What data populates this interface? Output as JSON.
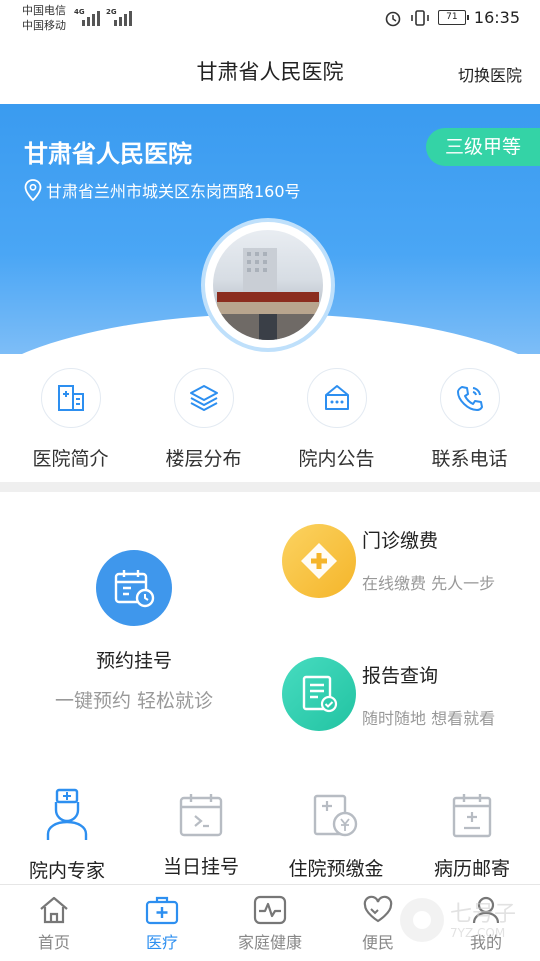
{
  "status_bar": {
    "carrier_1": "中国电信",
    "carrier_2": "中国移动",
    "net_1": "4G",
    "net_2": "2G",
    "battery": "71",
    "time": "16:35"
  },
  "header": {
    "title": "甘肃省人民医院",
    "switch_label": "切换医院"
  },
  "banner": {
    "hospital_name": "甘肃省人民医院",
    "grade": "三级甲等",
    "address": "甘肃省兰州市城关区东岗西路160号"
  },
  "quick_actions": [
    {
      "label": "医院简介",
      "icon": "building-icon"
    },
    {
      "label": "楼层分布",
      "icon": "layers-icon"
    },
    {
      "label": "院内公告",
      "icon": "notice-icon"
    },
    {
      "label": "联系电话",
      "icon": "phone-icon"
    }
  ],
  "services": {
    "appointment": {
      "title": "预约挂号",
      "subtitle": "一键预约 轻松就诊"
    },
    "payment": {
      "title": "门诊缴费",
      "subtitle": "在线缴费 先人一步"
    },
    "report": {
      "title": "报告查询",
      "subtitle": "随时随地 想看就看"
    }
  },
  "bottom_services": [
    {
      "label": "院内专家",
      "icon": "doctor-icon"
    },
    {
      "label": "当日挂号",
      "icon": "calendar-today-icon"
    },
    {
      "label": "住院预缴金",
      "icon": "deposit-icon"
    },
    {
      "label": "病历邮寄",
      "icon": "medical-record-icon"
    }
  ],
  "tabs": [
    {
      "label": "首页",
      "icon": "home-icon"
    },
    {
      "label": "医疗",
      "icon": "medical-kit-icon",
      "active": true
    },
    {
      "label": "家庭健康",
      "icon": "health-monitor-icon"
    },
    {
      "label": "便民",
      "icon": "heart-hands-icon"
    },
    {
      "label": "我的",
      "icon": "user-icon"
    }
  ],
  "watermark": {
    "text": "七号子",
    "sub": "7YZ.COM"
  },
  "colors": {
    "brand_blue": "#3a9bf0",
    "grade_green": "#34d3a6",
    "payment_yellow": "#f9c23c",
    "report_teal": "#2fcfb0",
    "active_tab": "#2d8ff0"
  }
}
